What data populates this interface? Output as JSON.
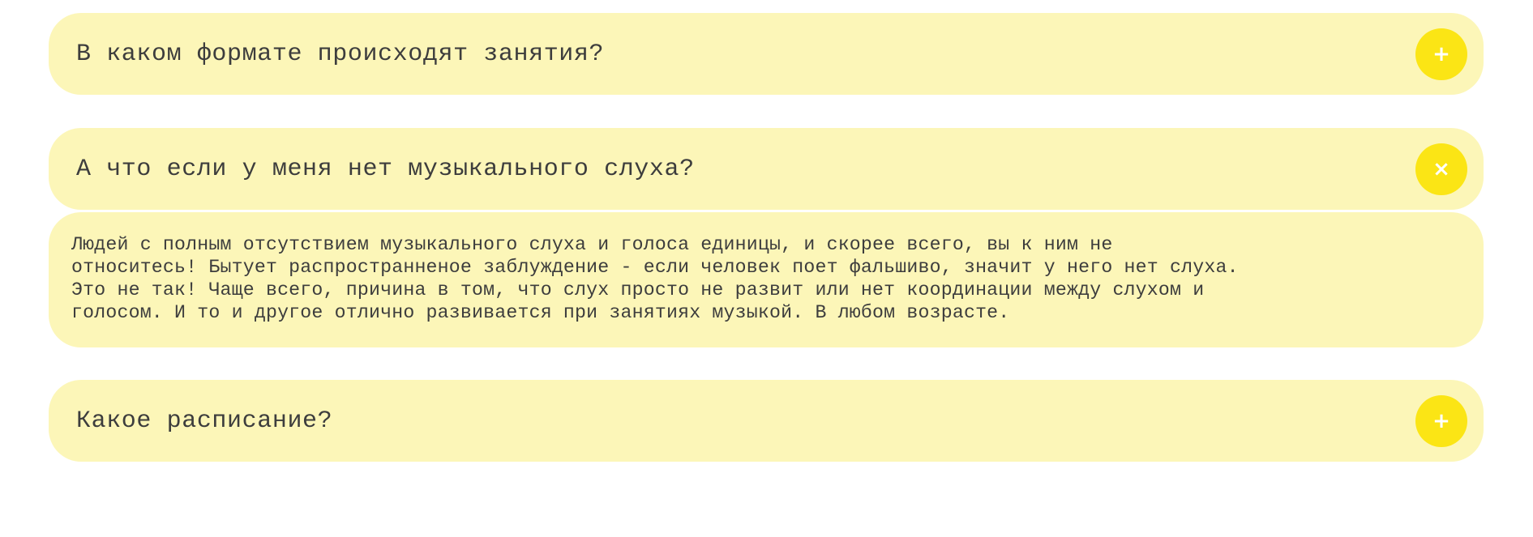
{
  "faq": {
    "items": [
      {
        "question": "В каком формате происходят занятия?",
        "toggle": "+",
        "toggle_icon": "plus-icon",
        "expanded": false
      },
      {
        "question": "А что если у меня нет музыкального слуха?",
        "toggle": "×",
        "toggle_icon": "close-icon",
        "expanded": true,
        "answer": "Людей с полным отсутствием музыкального слуха и голоса единицы, и скорее всего, вы к ним не\nотноситесь! Бытует распространненое заблуждение - если человек поет фальшиво, значит у него нет слуха.\nЭто не так! Чаще всего, причина в том, что слух просто не развит или нет координации между слухом и\nголосом. И то и другое отлично развивается при занятиях музыкой. В любом возрасте."
      },
      {
        "question": "Какое расписание?",
        "toggle": "+",
        "toggle_icon": "plus-icon",
        "expanded": false
      }
    ],
    "colors": {
      "card_background": "#fcf6b8",
      "toggle_background": "#fbe515",
      "toggle_icon": "#ffffff",
      "text": "#3d3d3d"
    }
  }
}
